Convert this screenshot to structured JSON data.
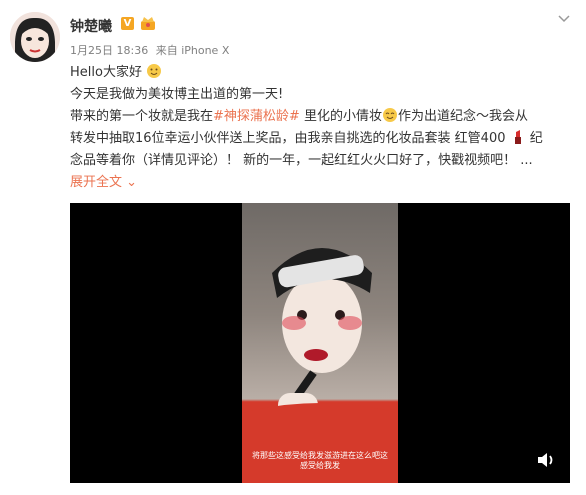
{
  "user": {
    "name": "钟楚曦",
    "verified_badge": "V"
  },
  "meta": {
    "date": "1月25日 18:36",
    "source": "来自 iPhone X"
  },
  "post": {
    "line1": "Hello大家好",
    "line2": "今天是我做为美妆博主出道的第一天!",
    "line3a": "带来的第一个妆就是我在",
    "topic": "#神探蒲松龄#",
    "line3b": " 里化的小倩妆",
    "line3c": "作为出道纪念～我会从",
    "line4": "转发中抽取16位幸运小伙伴送上奖品，由我亲自挑选的化妆品套装 红管400",
    "line4b": "纪",
    "line5": "念品等着你（详情见评论）！ 新的一年，一起红红火火口好了，快戳视频吧！  ...",
    "expand": "展开全文 ",
    "expand_arrow": "⌄"
  },
  "video": {
    "caption": "将那些这感受给我发滋游进在这么吧这感受给我发"
  },
  "colors": {
    "accent": "#eb7350",
    "meta_gray": "#808080",
    "badge": "#f5a623"
  },
  "icons": [
    "avatar",
    "verified-icon",
    "crown-badge-icon",
    "chevron-down-icon",
    "smile-emoji-icon",
    "lipstick-emoji-icon",
    "sound-icon"
  ]
}
